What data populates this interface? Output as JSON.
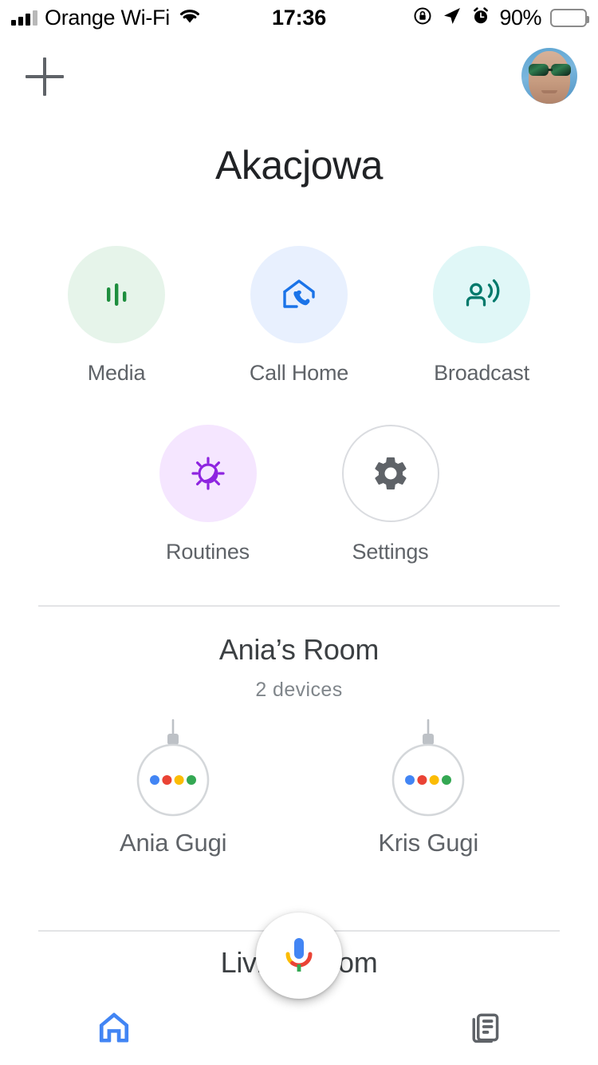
{
  "status_bar": {
    "carrier": "Orange Wi-Fi",
    "time": "17:36",
    "battery_percent": "90%",
    "signal_bars_filled": 3,
    "icons": [
      "signal-bars-icon",
      "wifi-icon",
      "rotation-lock-icon",
      "location-arrow-icon",
      "alarm-clock-icon",
      "battery-icon"
    ]
  },
  "header": {
    "add_label": "add-icon",
    "avatar_label": "account-avatar",
    "title": "Akacjowa"
  },
  "actions": {
    "row1": [
      {
        "label": "Media",
        "icon": "media-bars-icon",
        "bubble_color": "#e6f4ea",
        "icon_color": "#1e8e3e"
      },
      {
        "label": "Call Home",
        "icon": "call-home-icon",
        "bubble_color": "#e8f0fe",
        "icon_color": "#1a73e8"
      },
      {
        "label": "Broadcast",
        "icon": "broadcast-icon",
        "bubble_color": "#e0f7f7",
        "icon_color": "#00796b"
      }
    ],
    "row2": [
      {
        "label": "Routines",
        "icon": "routines-sun-moon-icon",
        "bubble_color": "#f5e6ff",
        "icon_color": "#8e24e0"
      },
      {
        "label": "Settings",
        "icon": "gear-icon",
        "bubble_color": "#ffffff",
        "icon_color": "#5f6368"
      }
    ]
  },
  "room": {
    "title": "Ania’s Room",
    "device_count": "2 devices",
    "devices": [
      {
        "name": "Ania Gugi",
        "icon": "nest-mini-speaker-icon"
      },
      {
        "name": "Kris Gugi",
        "icon": "nest-mini-speaker-icon"
      }
    ]
  },
  "next_room": {
    "title": "Living Room"
  },
  "assistant": {
    "mic_label": "google-assistant-mic"
  },
  "bottom_nav": [
    {
      "name": "home",
      "icon": "home-icon",
      "active": true,
      "color": "#4285f4"
    },
    {
      "name": "feed",
      "icon": "feed-icon",
      "active": false,
      "color": "#5f6368"
    }
  ],
  "colors": {
    "google_blue": "#4285f4",
    "google_red": "#ea4335",
    "google_yellow": "#fbbc04",
    "google_green": "#34a853"
  }
}
